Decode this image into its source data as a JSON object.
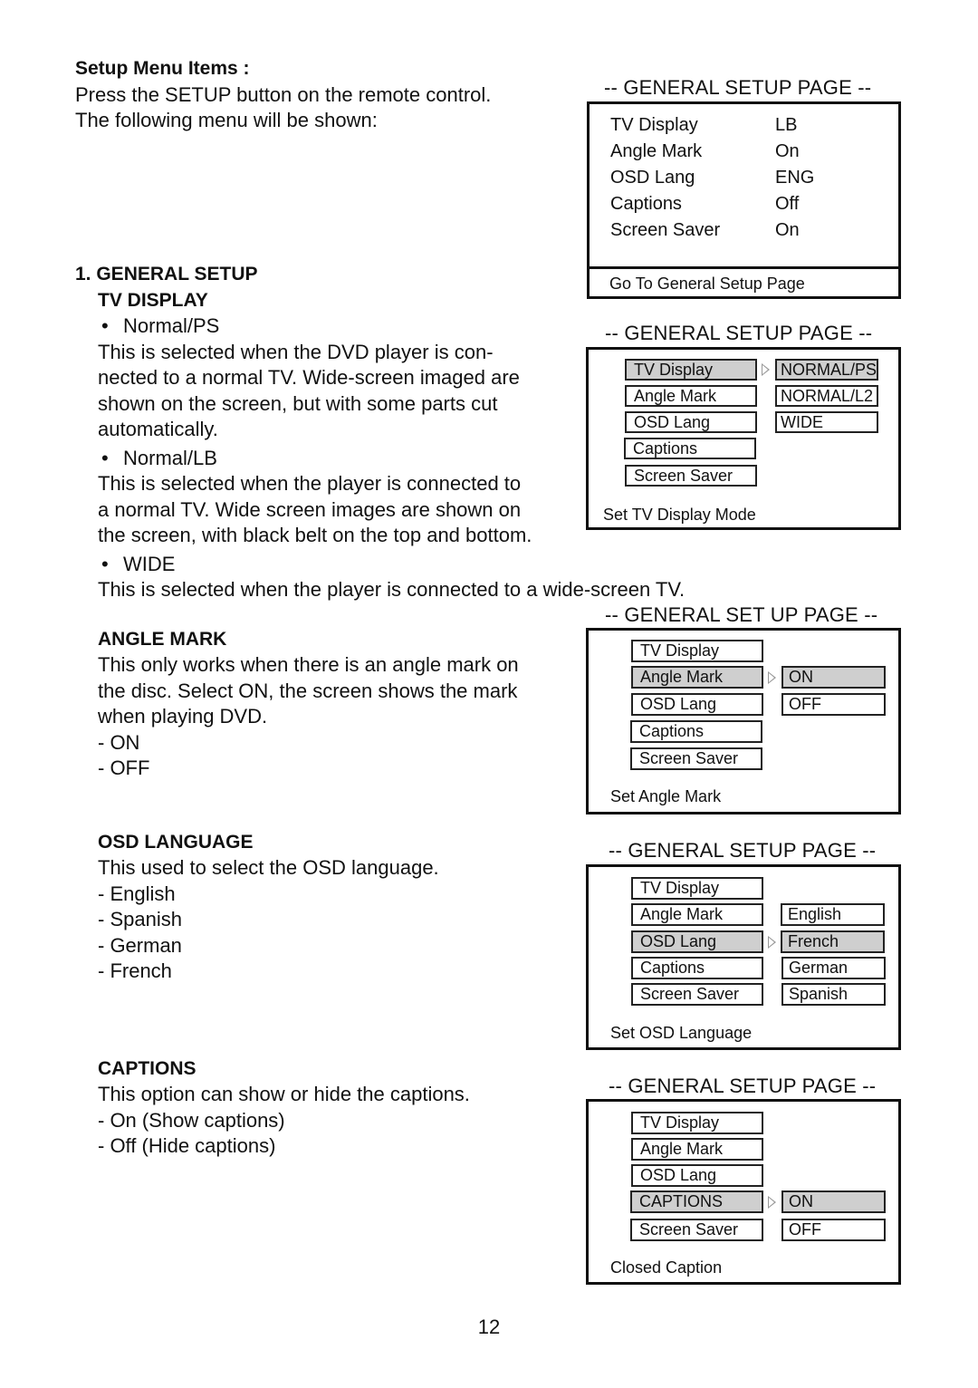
{
  "intro": {
    "heading": "Setup Menu Items :",
    "lines": [
      "Press the SETUP button on the remote control.",
      "The following menu will be shown:"
    ]
  },
  "general_setup": {
    "heading": "1. GENERAL SETUP",
    "tv_display": {
      "heading": "TV DISPLAY",
      "options": [
        {
          "bullet": "•",
          "label": "Normal/PS",
          "desc": [
            "This is selected when the DVD player is con-",
            "nected to a normal TV.  Wide-screen imaged are",
            "shown on the screen, but with some parts cut",
            "automatically."
          ]
        },
        {
          "bullet": "•",
          "label": "Normal/LB",
          "desc": [
            "This is selected when the player is connected to",
            "a normal TV. Wide screen images are shown on",
            "the screen, with black belt on the top and bottom."
          ]
        },
        {
          "bullet": "•",
          "label": "WIDE",
          "desc": [
            "This is selected when the player is connected to a wide-screen TV."
          ]
        }
      ]
    },
    "angle_mark": {
      "heading": "ANGLE MARK",
      "desc": [
        "This only works when there is an angle mark on",
        "the disc.  Select ON, the screen shows the mark",
        "when playing DVD."
      ],
      "options": [
        "- ON",
        "- OFF"
      ]
    },
    "osd_language": {
      "heading": "OSD LANGUAGE",
      "desc": [
        "This used to select the OSD language."
      ],
      "options": [
        "- English",
        "- Spanish",
        "- German",
        "- French"
      ]
    },
    "captions": {
      "heading": "CAPTIONS",
      "desc": [
        "This option can show or hide the captions."
      ],
      "options": [
        "- On (Show captions)",
        "- Off (Hide captions)"
      ]
    }
  },
  "panels": {
    "summary": {
      "title": "-- GENERAL SETUP PAGE --",
      "rows": [
        {
          "label": "TV Display",
          "value": "LB"
        },
        {
          "label": "Angle Mark",
          "value": "On"
        },
        {
          "label": "OSD Lang",
          "value": "ENG"
        },
        {
          "label": "Captions",
          "value": "Off"
        },
        {
          "label": "Screen Saver",
          "value": "On"
        }
      ],
      "footer": "Go To General Setup Page"
    },
    "tv_display": {
      "title": "-- GENERAL SETUP PAGE --",
      "menu": [
        "TV Display",
        "Angle Mark",
        "OSD Lang",
        "Captions",
        "Screen Saver"
      ],
      "selected_menu": 0,
      "options": [
        "NORMAL/PS",
        "NORMAL/L2",
        "WIDE"
      ],
      "selected_option": 0,
      "footer": "Set TV Display Mode"
    },
    "angle_mark": {
      "title": "-- GENERAL SET UP PAGE --",
      "menu": [
        "TV Display",
        "Angle Mark",
        "OSD Lang",
        "Captions",
        "Screen Saver"
      ],
      "selected_menu": 1,
      "options": [
        "ON",
        "OFF"
      ],
      "selected_option": 0,
      "footer": "Set Angle Mark"
    },
    "osd_lang": {
      "title": "-- GENERAL SETUP PAGE --",
      "menu": [
        "TV Display",
        "Angle Mark",
        "OSD Lang",
        "Captions",
        "Screen Saver"
      ],
      "selected_menu": 2,
      "options": [
        "English",
        "French",
        "German",
        "Spanish"
      ],
      "selected_option": 1,
      "footer": "Set OSD Language"
    },
    "captions": {
      "title": "-- GENERAL SETUP PAGE --",
      "menu": [
        "TV Display",
        "Angle Mark",
        "OSD Lang",
        "CAPTIONS",
        "Screen Saver"
      ],
      "selected_menu": 3,
      "options": [
        "ON",
        "OFF"
      ],
      "selected_option": 0,
      "footer": "Closed Caption"
    }
  },
  "colors": {
    "highlight": "#cfcfcf",
    "border": "#111111",
    "arrow": "#999999"
  },
  "page_number": "12"
}
